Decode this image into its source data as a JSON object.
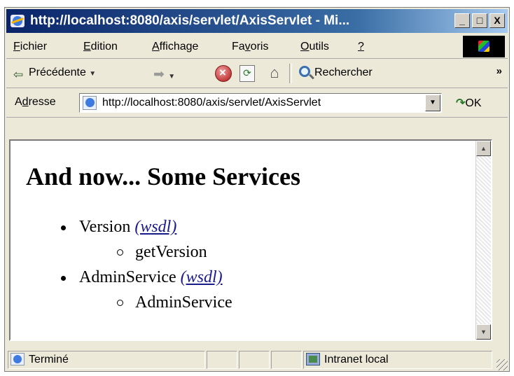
{
  "window": {
    "title": "http://localhost:8080/axis/servlet/AxisServlet - Mi...",
    "minimize": "_",
    "maximize": "□",
    "close": "X"
  },
  "menu": {
    "items": [
      {
        "label": "Fichier",
        "key": "F"
      },
      {
        "label": "Edition",
        "key": "E"
      },
      {
        "label": "Affichage",
        "key": "A"
      },
      {
        "label": "Favoris",
        "key": "v"
      },
      {
        "label": "Outils",
        "key": "O"
      },
      {
        "label": "?",
        "key": "?"
      }
    ]
  },
  "toolbar": {
    "back_label": "Précédente",
    "search_label": "Rechercher",
    "more": "»"
  },
  "address": {
    "label": "Adresse",
    "url": "http://localhost:8080/axis/servlet/AxisServlet",
    "go_label": "OK"
  },
  "page": {
    "heading": "And now... Some Services",
    "services": [
      {
        "name": "Version",
        "wsdl_label": "(wsdl)",
        "operations": [
          "getVersion"
        ]
      },
      {
        "name": "AdminService",
        "wsdl_label": "(wsdl)",
        "operations": [
          "AdminService"
        ]
      }
    ]
  },
  "status": {
    "text": "Terminé",
    "zone": "Intranet local"
  },
  "icons": [
    "ie-logo-icon",
    "back-arrow-icon",
    "forward-arrow-icon",
    "stop-icon",
    "refresh-icon",
    "home-icon",
    "search-icon",
    "page-icon",
    "go-arrow-icon",
    "zone-icon",
    "windows-logo-icon"
  ]
}
